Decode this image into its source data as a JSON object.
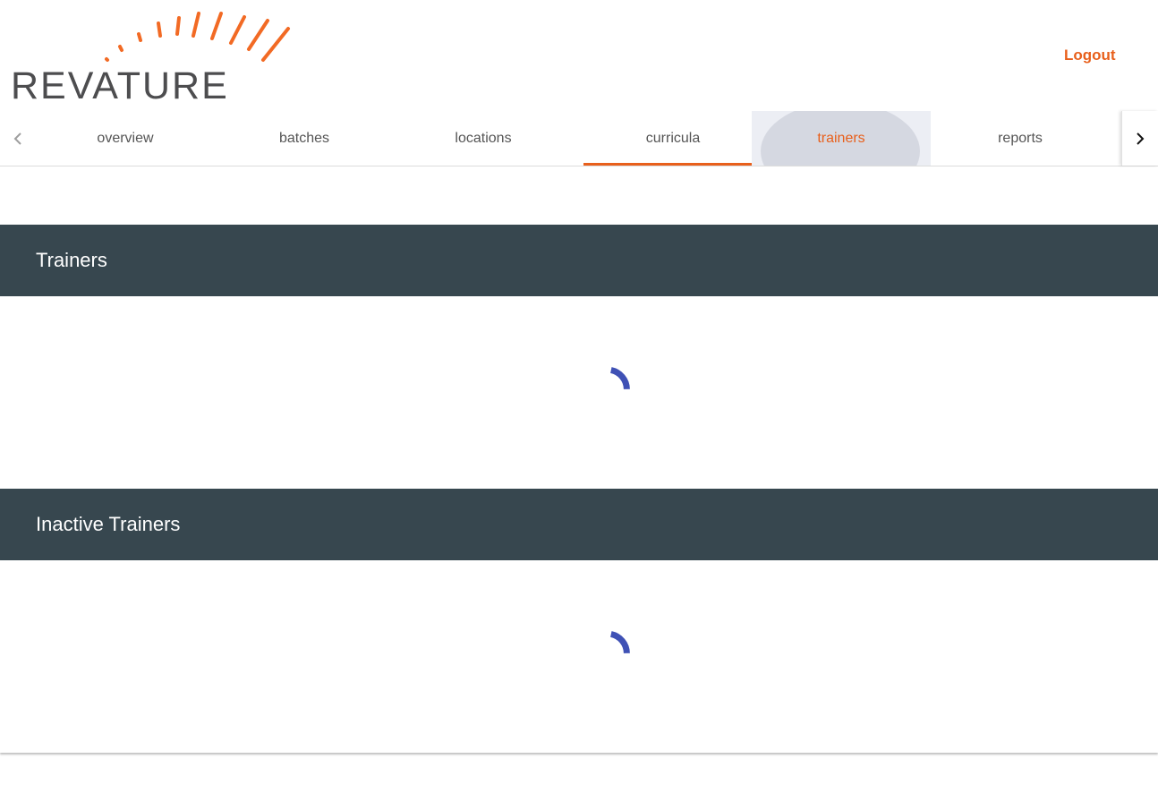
{
  "brand": {
    "name": "REVATURE",
    "text_color": "#4d4d4f",
    "accent_color": "#f26a24"
  },
  "header": {
    "logout_label": "Logout"
  },
  "tabs": [
    {
      "label": "overview",
      "state": "normal"
    },
    {
      "label": "batches",
      "state": "normal"
    },
    {
      "label": "locations",
      "state": "normal"
    },
    {
      "label": "curricula",
      "state": "active"
    },
    {
      "label": "trainers",
      "state": "focused"
    },
    {
      "label": "reports",
      "state": "normal"
    }
  ],
  "tab_nav": {
    "prev_icon": "chevron-left-icon",
    "next_icon": "chevron-right-icon"
  },
  "panels": [
    {
      "title": "Trainers",
      "loading": true
    },
    {
      "title": "Inactive Trainers",
      "loading": true
    }
  ],
  "colors": {
    "accent": "#e8601c",
    "panel_header_bg": "#37474f",
    "spinner": "#3f51b5"
  }
}
